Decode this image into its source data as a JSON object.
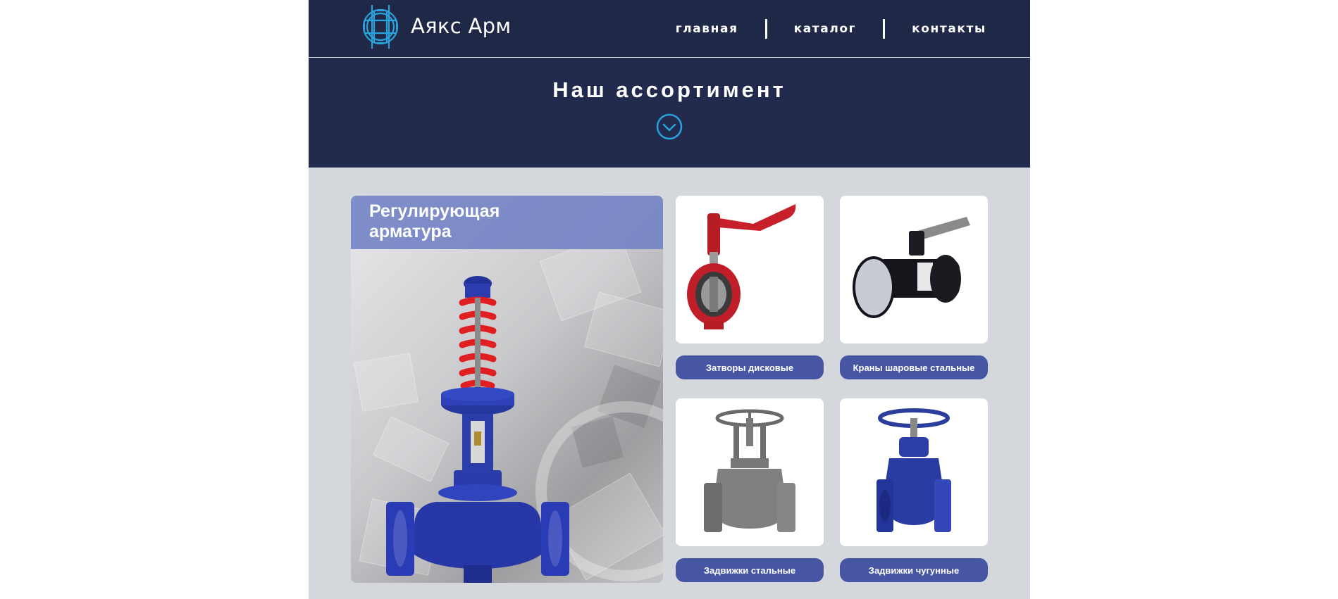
{
  "brand": {
    "name": "Аякс Арм",
    "logo_icon": "valve-logo-icon"
  },
  "nav": {
    "items": [
      {
        "label": "главная"
      },
      {
        "label": "каталог"
      },
      {
        "label": "контакты"
      }
    ]
  },
  "hero": {
    "title": "Наш ассортимент",
    "icon": "chevron-down-circle-icon"
  },
  "featured": {
    "title": "Регулирующая арматура",
    "image": "control-valve-image"
  },
  "products": [
    {
      "label": "Затворы дисковые",
      "image": "butterfly-valve-image"
    },
    {
      "label": "Краны шаровые стальные",
      "image": "ball-valve-image"
    },
    {
      "label": "Задвижки стальные",
      "image": "steel-gate-valve-image"
    },
    {
      "label": "Задвижки чугунные",
      "image": "cast-iron-gate-valve-image"
    }
  ],
  "colors": {
    "header_bg": "#1f2847",
    "hero_bg": "#222b4d",
    "accent_cyan": "#2aa3dc",
    "button_bg": "#4656a3",
    "page_bg": "#d4d8dc"
  }
}
